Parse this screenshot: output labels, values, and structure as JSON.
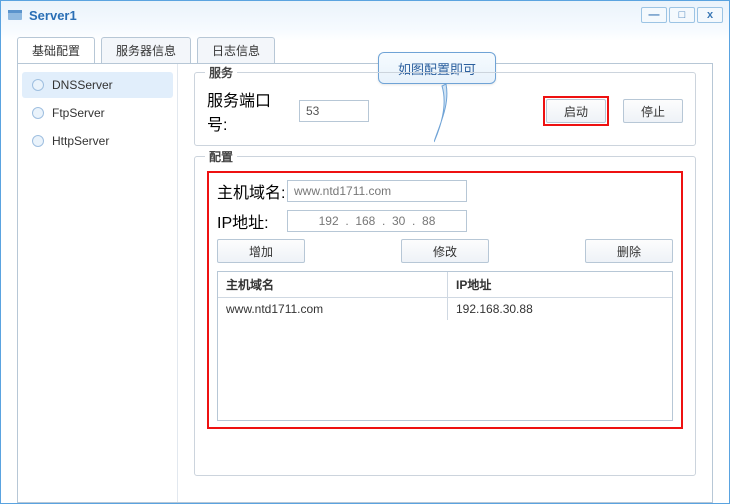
{
  "window": {
    "title": "Server1"
  },
  "win_controls": {
    "min": "—",
    "max": "□",
    "close": "x"
  },
  "tabs": [
    "基础配置",
    "服务器信息",
    "日志信息"
  ],
  "sidebar": {
    "items": [
      {
        "label": "DNSServer"
      },
      {
        "label": "FtpServer"
      },
      {
        "label": "HttpServer"
      }
    ]
  },
  "callout": {
    "text": "如图配置即可"
  },
  "service": {
    "legend": "服务",
    "port_label": "服务端口号:",
    "port_value": "53",
    "start_label": "启动",
    "stop_label": "停止"
  },
  "config": {
    "legend": "配置",
    "host_label": "主机域名:",
    "host_value": "www.ntd1711.com",
    "ip_label": "IP地址:",
    "ip_value": "192  .  168  .  30  .  88",
    "add_label": "增加",
    "edit_label": "修改",
    "del_label": "删除",
    "columns": [
      "主机域名",
      "IP地址"
    ],
    "rows": [
      {
        "host": "www.ntd1711.com",
        "ip": "192.168.30.88"
      }
    ]
  }
}
